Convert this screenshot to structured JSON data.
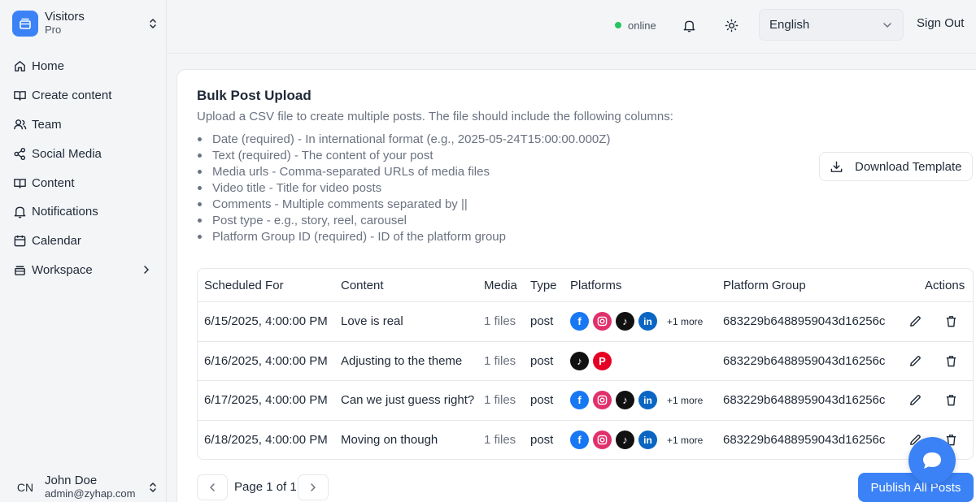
{
  "workspace": {
    "name": "Visitors",
    "plan": "Pro"
  },
  "nav": {
    "items": [
      {
        "label": "Home",
        "icon": "home-icon"
      },
      {
        "label": "Create content",
        "icon": "book-icon"
      },
      {
        "label": "Team",
        "icon": "users-icon"
      },
      {
        "label": "Social Media",
        "icon": "share-icon"
      },
      {
        "label": "Content",
        "icon": "book-icon"
      },
      {
        "label": "Notifications",
        "icon": "bell-icon"
      },
      {
        "label": "Calendar",
        "icon": "calendar-icon"
      },
      {
        "label": "Workspace",
        "icon": "layers-icon"
      }
    ]
  },
  "user": {
    "initials": "CN",
    "name": "John Doe",
    "email": "admin@zyhap.com"
  },
  "header": {
    "status": "online",
    "language": "English",
    "sign_out": "Sign Out"
  },
  "upload": {
    "title": "Bulk Post Upload",
    "description": "Upload a CSV file to create multiple posts. The file should include the following columns:",
    "columns": [
      "Date (required) - In international format (e.g., 2025-05-24T15:00:00.000Z)",
      "Text (required) - The content of your post",
      "Media urls - Comma-separated URLs of media files",
      "Video title - Title for video posts",
      "Comments - Multiple comments separated by ||",
      "Post type - e.g., story, reel, carousel",
      "Platform Group ID (required) - ID of the platform group"
    ],
    "download_label": "Download Template"
  },
  "table": {
    "headers": {
      "scheduled": "Scheduled For",
      "content": "Content",
      "media": "Media",
      "type": "Type",
      "platforms": "Platforms",
      "group": "Platform Group",
      "actions": "Actions"
    },
    "rows": [
      {
        "scheduled": "6/15/2025, 4:00:00 PM",
        "content": "Love is real",
        "media": "1 files",
        "type": "post",
        "platforms": [
          "facebook",
          "instagram",
          "tiktok",
          "linkedin"
        ],
        "more": "+1 more",
        "group": "683229b6488959043d16256c"
      },
      {
        "scheduled": "6/16/2025, 4:00:00 PM",
        "content": "Adjusting to the theme",
        "media": "1 files",
        "type": "post",
        "platforms": [
          "tiktok",
          "pinterest"
        ],
        "more": "",
        "group": "683229b6488959043d16256c"
      },
      {
        "scheduled": "6/17/2025, 4:00:00 PM",
        "content": "Can we just guess right?",
        "media": "1 files",
        "type": "post",
        "platforms": [
          "facebook",
          "instagram",
          "tiktok",
          "linkedin"
        ],
        "more": "+1 more",
        "group": "683229b6488959043d16256c"
      },
      {
        "scheduled": "6/18/2025, 4:00:00 PM",
        "content": "Moving on though",
        "media": "1 files",
        "type": "post",
        "platforms": [
          "facebook",
          "instagram",
          "tiktok",
          "linkedin"
        ],
        "more": "+1 more",
        "group": "683229b6488959043d16256c"
      }
    ]
  },
  "pagination": {
    "text": "Page 1 of 1"
  },
  "publish_label": "Publish All Posts",
  "colors": {
    "accent": "#3b82f6",
    "online": "#22c55e"
  }
}
